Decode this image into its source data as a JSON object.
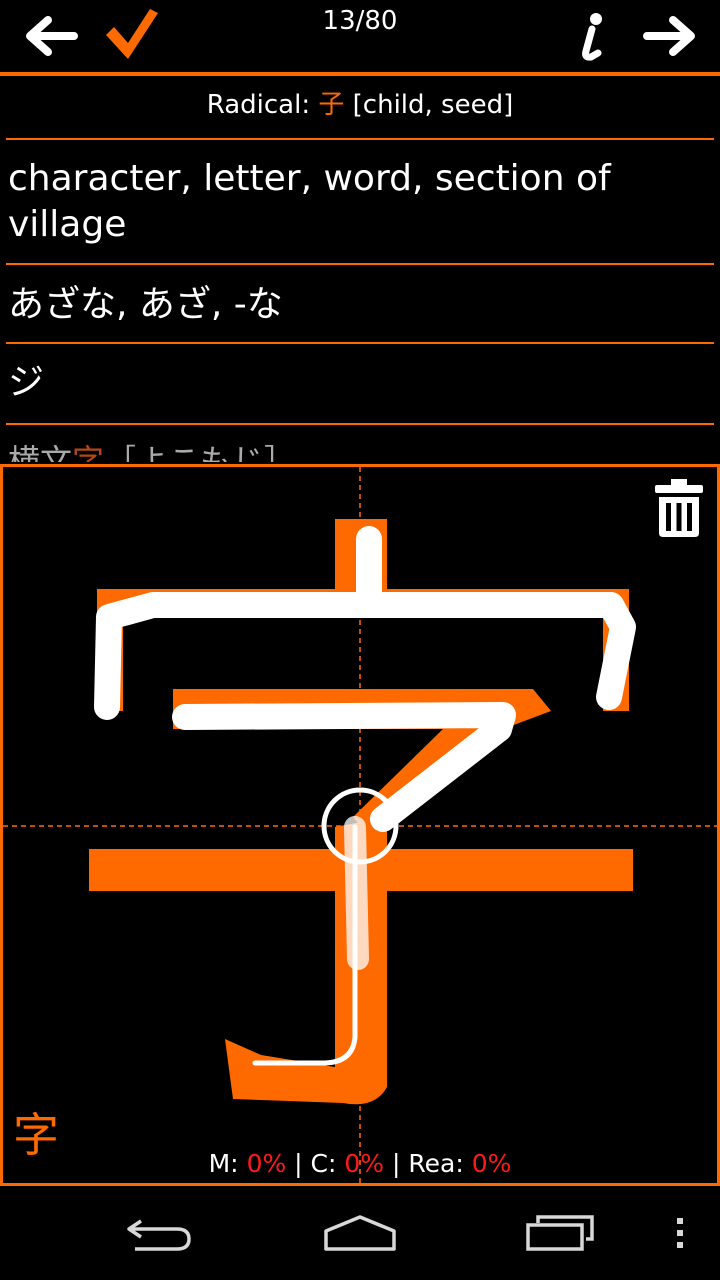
{
  "header": {
    "counter": "13/80",
    "back_icon": "arrow-left-icon",
    "check_icon": "checkmark-icon",
    "info_icon": "info-icon",
    "next_icon": "arrow-right-icon"
  },
  "radical": {
    "label": "Radical: ",
    "kanji": "子",
    "meaning": " [child, seed]"
  },
  "entry": {
    "meaning": "character, letter, word, section of village",
    "kun_reading": "あざな, あざ, -な",
    "on_reading": "ジ",
    "example_prefix": "横文",
    "example_kanji": "字",
    "example_suffix": "［よこもじ］"
  },
  "canvas": {
    "kanji": "字",
    "trash_icon": "trash-icon",
    "stats": {
      "m_label": "M: ",
      "m_value": "0%",
      "c_label": " | C: ",
      "c_value": "0%",
      "rea_label": " | Rea: ",
      "rea_value": "0%"
    }
  },
  "navbar": {
    "back_icon": "nav-back-icon",
    "home_icon": "nav-home-icon",
    "recents_icon": "nav-recents-icon",
    "menu_icon": "nav-menu-icon"
  },
  "colors": {
    "accent": "#ff6a00",
    "background": "#000000",
    "stats_value": "#ff1a1a"
  }
}
